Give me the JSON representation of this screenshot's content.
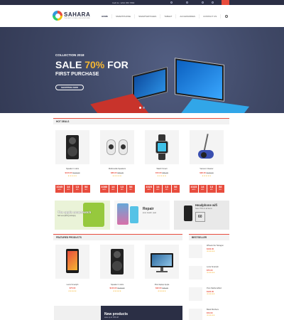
{
  "topbar": {
    "phone": "Call Us: 1234 456 7890"
  },
  "brand": {
    "name": "SAHARA",
    "tagline": "THE BEST STORE FOR EVERYONE"
  },
  "nav": [
    "HOME",
    "SMARTPHONE",
    "SMARTWATCHES",
    "TABLET",
    "ACCESSORIES",
    "CONTACT US"
  ],
  "hero": {
    "kicker": "COLLECTION 2018",
    "headline_prefix": "SALE ",
    "headline_pct": "70%",
    "headline_suffix": " FOR",
    "sub": "FIRST PURCHASE",
    "button": "SHOPPING NOW"
  },
  "hot_deals": {
    "title": "HOT DEALS",
    "products": [
      {
        "title": "Speaker in dots",
        "price_new": "$120.00",
        "price_old": "$140.00",
        "stars": "★★★★★",
        "countdown": [
          "1045",
          "14",
          "13",
          "58"
        ]
      },
      {
        "title": "Multimedia Speakers",
        "price_new": "$86.00",
        "price_old": "$90.00",
        "stars": "★★★★★",
        "countdown": [
          "1080",
          "14",
          "13",
          "58"
        ]
      },
      {
        "title": "Watch Smart",
        "price_new": "$72.00",
        "price_old": "$80.00",
        "stars": "★★★★★",
        "countdown": [
          "1023",
          "14",
          "13",
          "58"
        ]
      },
      {
        "title": "Vacuum Cleaner",
        "price_new": "$90.00",
        "price_old": "$100.00",
        "stars": "★★★★★",
        "countdown": [
          "1023",
          "14",
          "13",
          "58"
        ]
      }
    ],
    "countdown_labels": [
      "DAYS",
      "HRS",
      "MIN",
      "SEC"
    ]
  },
  "banners": [
    {
      "title": "The apple smartwatch",
      "sub": "Sell everything & Enjoy"
    },
    {
      "title": "Repair",
      "sub": "Ipod, Iwatch, Ipad"
    },
    {
      "title": "Headphone wifi",
      "sub": "Save 70% on all items"
    }
  ],
  "featured": {
    "title": "FEATURED PRODUCTS",
    "products": [
      {
        "title": "Lenis Smartph",
        "price_new": "$75.00",
        "price_old": "",
        "stars": "★★★★★"
      },
      {
        "title": "Speaker in dots",
        "price_new": "$120.00",
        "price_old": "$140.00",
        "stars": "★★★★★"
      },
      {
        "title": "Pixel laptop Apple",
        "price_new": "$32.00",
        "price_old": "$36.00",
        "stars": "★★★★★"
      }
    ]
  },
  "bestseller": {
    "title": "BESTSELLER",
    "items": [
      {
        "title": "Wheels the Tarragon",
        "price": "$102.00",
        "stars": "★★★★★"
      },
      {
        "title": "Lenis Smartph",
        "price": "$75.00",
        "stars": "★★★★★"
      },
      {
        "title": "Pure Media Adfect",
        "price": "$120.00",
        "stars": "★★★★★"
      },
      {
        "title": "Black Brothers",
        "price": "$72.00",
        "stars": "★★★★★"
      }
    ]
  },
  "bottom_promo": {
    "title": "New products",
    "sub": "save up to 70% off"
  }
}
